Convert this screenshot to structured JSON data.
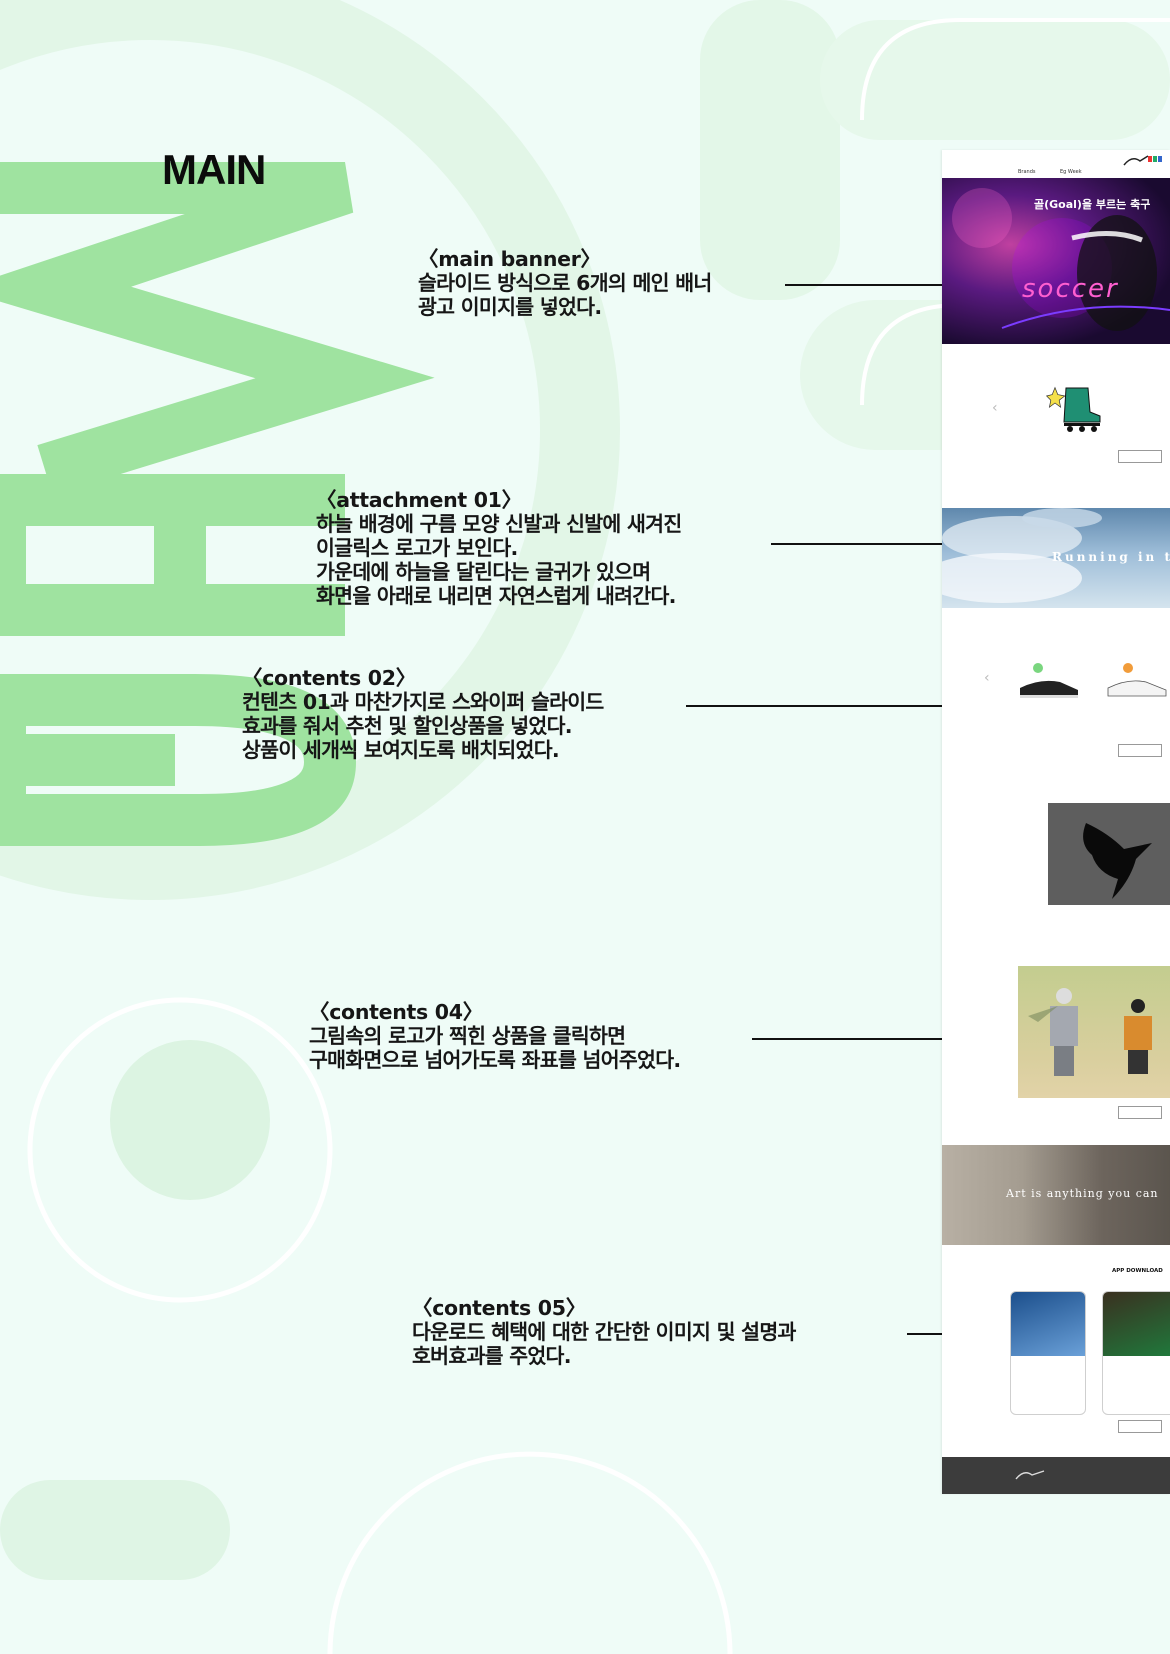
{
  "page": {
    "heading": "MAIN",
    "watermark": "WEB",
    "colors": {
      "background": "#effcf7",
      "accent_green": "#9fe3a0",
      "line": "#111111"
    }
  },
  "annotations": [
    {
      "title": "〈main banner〉",
      "lines": [
        "슬라이드 방식으로 6개의 메인 배너",
        "광고 이미지를 넣었다."
      ]
    },
    {
      "title": "〈attachment 01〉",
      "lines": [
        "하늘 배경에 구름 모양 신발과 신발에 새겨진",
        "이글릭스 로고가 보인다.",
        "가운데에 하늘을 달린다는 글귀가 있으며",
        "화면을 아래로 내리면 자연스럽게 내려간다."
      ]
    },
    {
      "title": "〈contents 02〉",
      "lines": [
        "컨텐츠 01과 마찬가지로 스와이퍼 슬라이드",
        "효과를 줘서 추천 및 할인상품을 넣었다.",
        "상품이 세개씩 보여지도록 배치되었다."
      ]
    },
    {
      "title": "〈contents 04〉",
      "lines": [
        "그림속의 로고가 찍힌 상품을 클릭하면",
        "구매화면으로 넘어가도록 좌표를 넘어주었다."
      ]
    },
    {
      "title": "〈contents 05〉",
      "lines": [
        "다운로드 혜택에 대한 간단한 이미지 및 설명과",
        "호버효과를 주었다."
      ]
    }
  ],
  "mockup": {
    "nav": [
      "Brands",
      "Eg Week"
    ],
    "hero_title": "골(Goal)을 부르는 축구",
    "hero_word": "soccer",
    "sky_text": "Running in t",
    "art_text": "Art is anything you can",
    "app_title": "APP DOWNLOAD"
  }
}
